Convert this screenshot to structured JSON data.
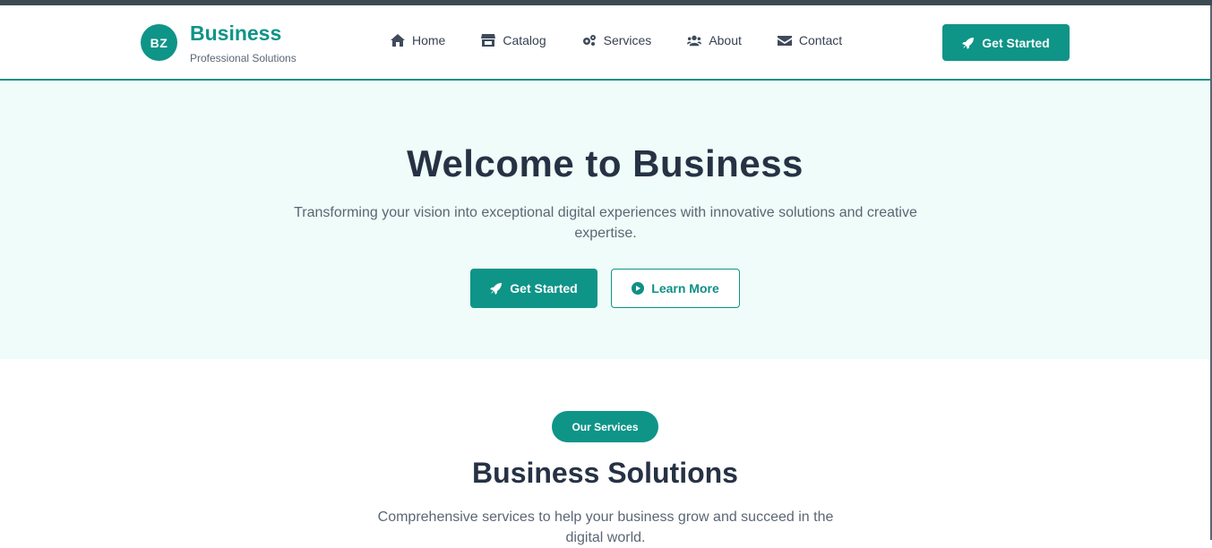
{
  "brand": {
    "logo_initials": "BZ",
    "name": "Business",
    "tagline": "Professional Solutions"
  },
  "nav": {
    "links": [
      {
        "label": "Home",
        "icon": "home-icon"
      },
      {
        "label": "Catalog",
        "icon": "store-icon"
      },
      {
        "label": "Services",
        "icon": "cogs-icon"
      },
      {
        "label": "About",
        "icon": "users-icon"
      },
      {
        "label": "Contact",
        "icon": "envelope-icon"
      }
    ],
    "cta_label": "Get Started"
  },
  "hero": {
    "title": "Welcome to Business",
    "subtitle": "Transforming your vision into exceptional digital experiences with innovative solutions and creative expertise.",
    "primary_label": "Get Started",
    "secondary_label": "Learn More"
  },
  "services": {
    "badge": "Our Services",
    "title": "Business Solutions",
    "subtitle": "Comprehensive services to help your business grow and succeed in the digital world."
  },
  "colors": {
    "accent": "#0f9488",
    "heading": "#263244",
    "hero_bg": "#effcf9",
    "muted_text": "#5b6675"
  }
}
